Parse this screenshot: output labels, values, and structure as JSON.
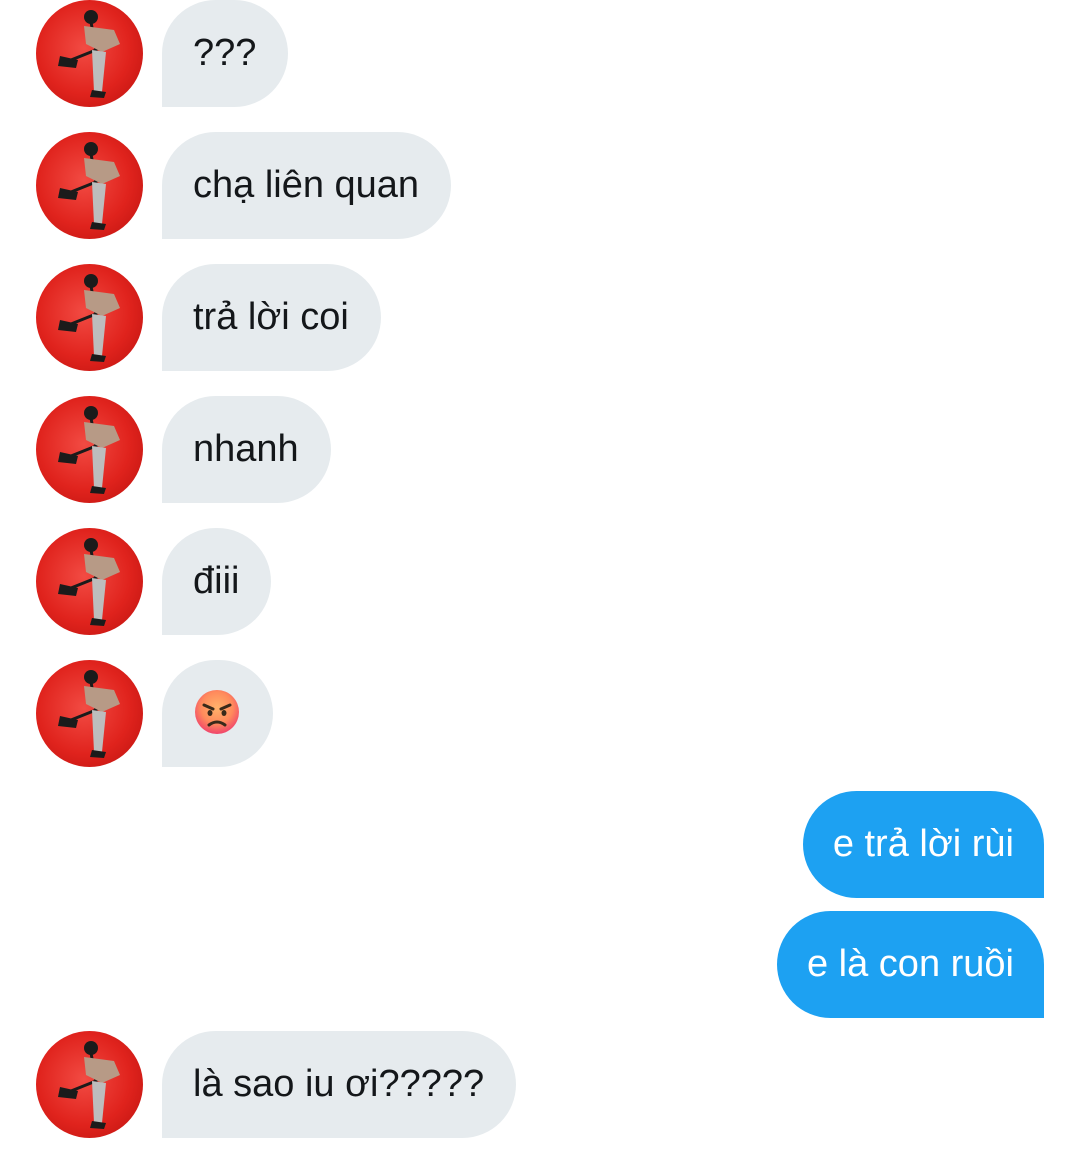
{
  "messages": [
    {
      "side": "in",
      "text": "???"
    },
    {
      "side": "in",
      "text": "chạ liên quan"
    },
    {
      "side": "in",
      "text": "trả lời coi"
    },
    {
      "side": "in",
      "text": "nhanh"
    },
    {
      "side": "in",
      "text": "điii"
    },
    {
      "side": "in",
      "emoji": "angry-face-emoji"
    },
    {
      "side": "out",
      "text": "e trả lời rùi"
    },
    {
      "side": "out",
      "text": "e là con ruồi"
    },
    {
      "side": "in",
      "text": "là sao iu ơi?????"
    }
  ],
  "colors": {
    "incoming_bubble": "#e6ebee",
    "incoming_text": "#14171a",
    "outgoing_bubble": "#1da1f2",
    "outgoing_text": "#ffffff",
    "avatar_background": "#e0231d"
  },
  "avatar": {
    "icon": "user-avatar-icon"
  }
}
